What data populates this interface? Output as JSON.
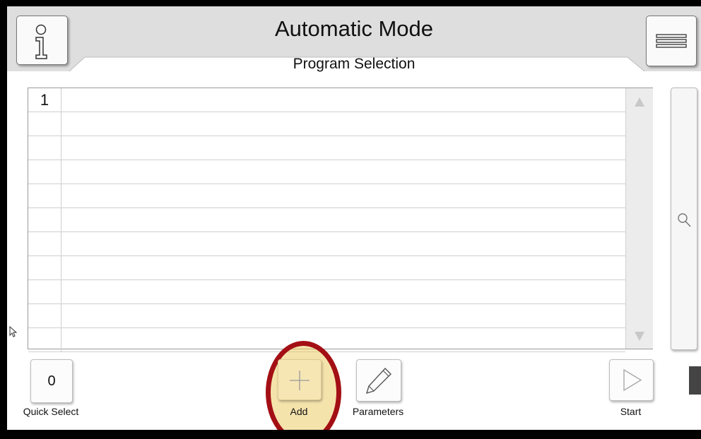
{
  "header": {
    "title": "Automatic Mode",
    "subtitle": "Program Selection",
    "info_icon": "info-icon",
    "menu_icon": "hamburger-menu-icon"
  },
  "program_list": {
    "rows": [
      {
        "number": "1",
        "name": ""
      },
      {
        "number": "",
        "name": ""
      },
      {
        "number": "",
        "name": ""
      },
      {
        "number": "",
        "name": ""
      },
      {
        "number": "",
        "name": ""
      },
      {
        "number": "",
        "name": ""
      },
      {
        "number": "",
        "name": ""
      },
      {
        "number": "",
        "name": ""
      },
      {
        "number": "",
        "name": ""
      },
      {
        "number": "",
        "name": ""
      },
      {
        "number": "",
        "name": ""
      }
    ],
    "scroll_up_icon": "triangle-up-icon",
    "scroll_down_icon": "triangle-down-icon",
    "search_icon": "magnifier-icon"
  },
  "toolbar": {
    "quick_select_value": "0",
    "quick_select_label": "Quick Select",
    "add_label": "Add",
    "add_icon": "plus-icon",
    "parameters_label": "Parameters",
    "parameters_icon": "pencil-icon",
    "start_label": "Start",
    "start_icon": "play-triangle-icon"
  },
  "colors": {
    "header_bg": "#dedede",
    "add_button_bg": "#f6e6b4",
    "highlight_ring": "#a30f14"
  }
}
